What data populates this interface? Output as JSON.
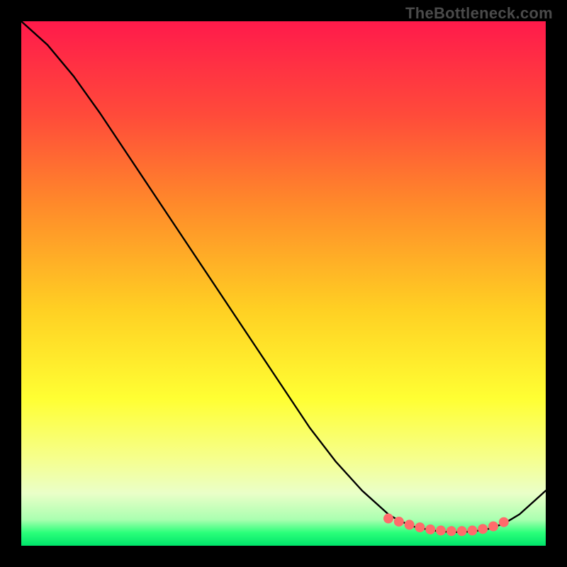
{
  "watermark": "TheBottleneck.com",
  "chart_data": {
    "type": "line",
    "title": "",
    "xlabel": "",
    "ylabel": "",
    "xlim": [
      0,
      100
    ],
    "ylim": [
      0,
      100
    ],
    "grid": false,
    "legend": false,
    "background_gradient": {
      "stops": [
        {
          "offset": 0.0,
          "color": "#ff1a4b"
        },
        {
          "offset": 0.18,
          "color": "#ff4b3a"
        },
        {
          "offset": 0.35,
          "color": "#ff8a2a"
        },
        {
          "offset": 0.55,
          "color": "#ffd023"
        },
        {
          "offset": 0.72,
          "color": "#ffff33"
        },
        {
          "offset": 0.83,
          "color": "#f6ff8a"
        },
        {
          "offset": 0.9,
          "color": "#eaffc8"
        },
        {
          "offset": 0.95,
          "color": "#aaffb0"
        },
        {
          "offset": 0.975,
          "color": "#2bff7a"
        },
        {
          "offset": 1.0,
          "color": "#00e56a"
        }
      ]
    },
    "series": [
      {
        "name": "curve",
        "color": "#000000",
        "x": [
          0,
          5,
          10,
          15,
          20,
          25,
          30,
          35,
          40,
          45,
          50,
          55,
          60,
          65,
          70,
          72,
          75,
          78,
          80,
          83,
          86,
          89,
          92,
          95,
          100
        ],
        "y": [
          100,
          95.5,
          89.5,
          82.5,
          75.0,
          67.5,
          60.0,
          52.5,
          45.0,
          37.5,
          30.0,
          22.5,
          16.0,
          10.5,
          6.0,
          4.8,
          3.6,
          3.0,
          2.7,
          2.6,
          2.7,
          3.2,
          4.2,
          6.0,
          10.5
        ]
      }
    ],
    "markers": {
      "name": "bottom-dots",
      "color": "#ff6b6b",
      "radius": 7,
      "points": [
        {
          "x": 70,
          "y": 5.2
        },
        {
          "x": 72,
          "y": 4.6
        },
        {
          "x": 74,
          "y": 4.0
        },
        {
          "x": 76,
          "y": 3.5
        },
        {
          "x": 78,
          "y": 3.1
        },
        {
          "x": 80,
          "y": 2.9
        },
        {
          "x": 82,
          "y": 2.8
        },
        {
          "x": 84,
          "y": 2.8
        },
        {
          "x": 86,
          "y": 2.9
        },
        {
          "x": 88,
          "y": 3.2
        },
        {
          "x": 90,
          "y": 3.7
        },
        {
          "x": 92,
          "y": 4.5
        }
      ]
    }
  }
}
